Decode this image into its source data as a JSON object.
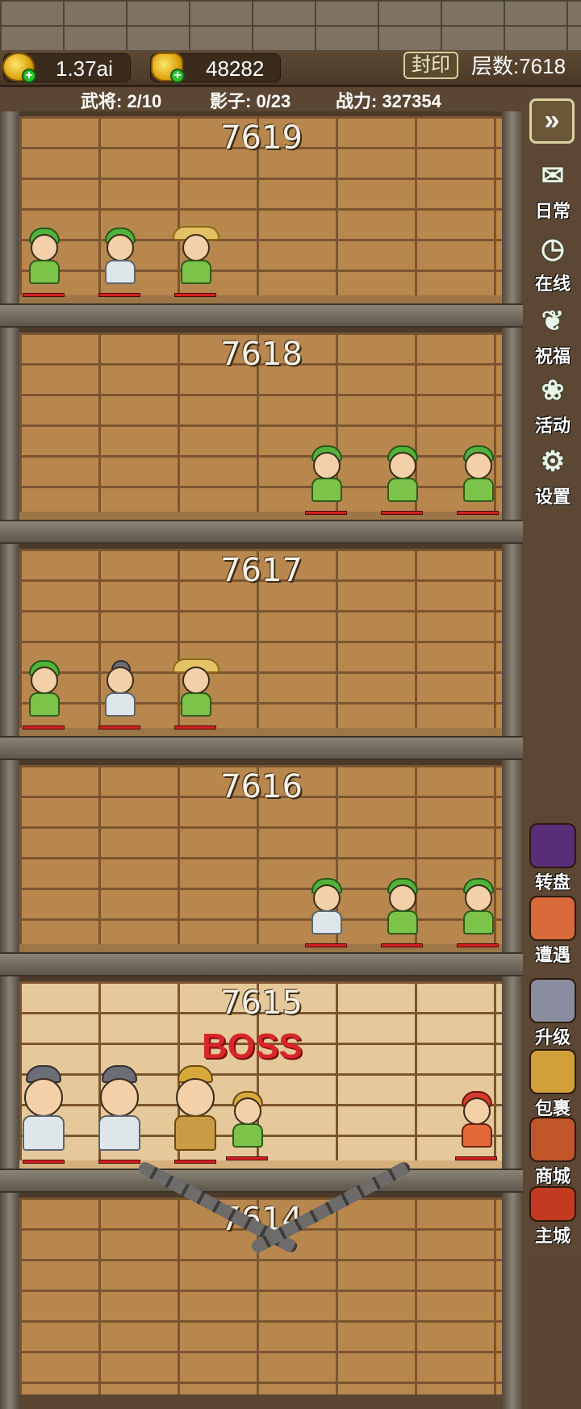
{
  "resources": {
    "coins": "1.37ai",
    "ingots": "48282"
  },
  "header": {
    "seal_label": "封印",
    "floor_count": "层数:7618"
  },
  "stats": {
    "generals": "武将: 2/10",
    "shadows": "影子: 0/23",
    "power": "战力: 327354"
  },
  "floors": [
    {
      "number": "7619"
    },
    {
      "number": "7618"
    },
    {
      "number": "7617"
    },
    {
      "number": "7616"
    },
    {
      "number": "7615",
      "label": "BOSS"
    },
    {
      "number": "7614"
    }
  ],
  "sidebar": {
    "fast_forward_icon": "double-chevron-right-icon",
    "items": [
      {
        "label": "日常",
        "icon": "scroll-icon"
      },
      {
        "label": "在线",
        "icon": "clock-icon"
      },
      {
        "label": "祝福",
        "icon": "book-icon"
      },
      {
        "label": "活动",
        "icon": "gift-icon"
      },
      {
        "label": "设置",
        "icon": "gear-icon"
      },
      {
        "label": "转盘",
        "icon": "wheel-icon"
      },
      {
        "label": "遭遇",
        "icon": "encounter-icon"
      },
      {
        "label": "升级",
        "icon": "upgrade-icon"
      },
      {
        "label": "包裹",
        "icon": "bag-icon"
      },
      {
        "label": "商城",
        "icon": "shop-icon"
      },
      {
        "label": "主城",
        "icon": "castle-icon"
      }
    ]
  }
}
